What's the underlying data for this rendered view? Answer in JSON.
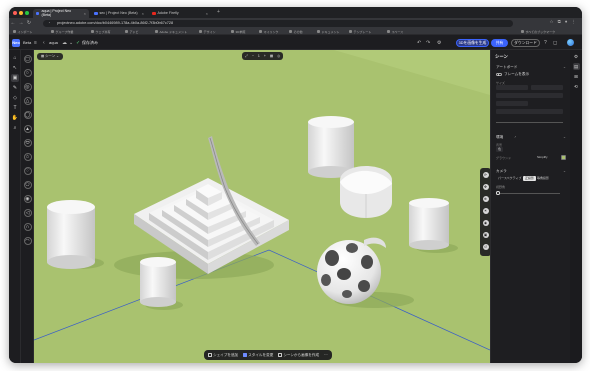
{
  "browser": {
    "tabs": [
      {
        "label": "aqua | Project Neo (Beta)",
        "active": true
      },
      {
        "label": "sec | Project Neo (Beta)",
        "active": false
      },
      {
        "label": "Adobe Firefly",
        "active": false
      }
    ],
    "url": "projectneo.adobe.com/doc/b0446989-178a-4b0a-86f2-7f3b0b67c728",
    "bookmarks": [
      "インポート",
      "グループ作業",
      "ウェブ共有",
      "アドビ",
      "Adobe ドキュメント",
      "デザイン",
      "3D参照",
      "マイリンク",
      "その他",
      "ドキュメント",
      "テンプレート",
      "スペース",
      "すべてのブックマーク"
    ]
  },
  "app": {
    "brand": "Neo",
    "beta_label": "Beta",
    "doc_name": "aqua",
    "save_status": "保存済み",
    "share_button": "共有",
    "export_button": "ダウンロード",
    "generate_button": "3Dを画像を生成"
  },
  "canvas": {
    "scene_pill": "シーン",
    "zoom_value": "1",
    "bottom_actions": [
      {
        "label": "シェイプを追加"
      },
      {
        "label": "スタイルを変更"
      },
      {
        "label": "シーンから画像を作成"
      }
    ],
    "background_color": "#a9c26f"
  },
  "panel": {
    "title": "シーン",
    "artboard_section": "アートボード",
    "frame_toggle": "フレームを表示",
    "size_label": "サイズ",
    "lighting_section": "環境",
    "color_label": "背景",
    "color_mode": "色",
    "ground_label": "グラウンド",
    "ground_value": "Simplify",
    "ground_color": "#a9c26f",
    "camera_section": "カメラ",
    "camera_modes": [
      "パースペクティブ",
      "正投影",
      "等角投影"
    ],
    "camera_active_index": 1,
    "fov_label": "視野角"
  }
}
